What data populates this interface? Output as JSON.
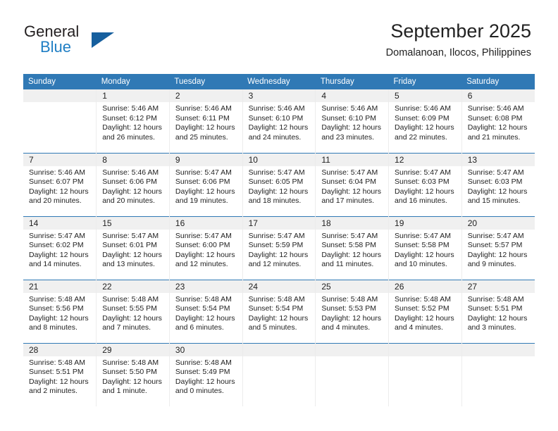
{
  "brand": {
    "name_part1": "General",
    "name_part2": "Blue",
    "logo_icon": "triangle-logo"
  },
  "header": {
    "title": "September 2025",
    "location": "Domalanoan, Ilocos, Philippines"
  },
  "colors": {
    "header_blue": "#3079b5",
    "brand_blue": "#1f7ec4",
    "logo_blue": "#165f9e",
    "day_strip_gray": "#f0f0f0"
  },
  "weekday_headers": [
    "Sunday",
    "Monday",
    "Tuesday",
    "Wednesday",
    "Thursday",
    "Friday",
    "Saturday"
  ],
  "weeks": [
    [
      {
        "day": "",
        "lines": []
      },
      {
        "day": "1",
        "lines": [
          "Sunrise: 5:46 AM",
          "Sunset: 6:12 PM",
          "Daylight: 12 hours",
          "and 26 minutes."
        ]
      },
      {
        "day": "2",
        "lines": [
          "Sunrise: 5:46 AM",
          "Sunset: 6:11 PM",
          "Daylight: 12 hours",
          "and 25 minutes."
        ]
      },
      {
        "day": "3",
        "lines": [
          "Sunrise: 5:46 AM",
          "Sunset: 6:10 PM",
          "Daylight: 12 hours",
          "and 24 minutes."
        ]
      },
      {
        "day": "4",
        "lines": [
          "Sunrise: 5:46 AM",
          "Sunset: 6:10 PM",
          "Daylight: 12 hours",
          "and 23 minutes."
        ]
      },
      {
        "day": "5",
        "lines": [
          "Sunrise: 5:46 AM",
          "Sunset: 6:09 PM",
          "Daylight: 12 hours",
          "and 22 minutes."
        ]
      },
      {
        "day": "6",
        "lines": [
          "Sunrise: 5:46 AM",
          "Sunset: 6:08 PM",
          "Daylight: 12 hours",
          "and 21 minutes."
        ]
      }
    ],
    [
      {
        "day": "7",
        "lines": [
          "Sunrise: 5:46 AM",
          "Sunset: 6:07 PM",
          "Daylight: 12 hours",
          "and 20 minutes."
        ]
      },
      {
        "day": "8",
        "lines": [
          "Sunrise: 5:46 AM",
          "Sunset: 6:06 PM",
          "Daylight: 12 hours",
          "and 20 minutes."
        ]
      },
      {
        "day": "9",
        "lines": [
          "Sunrise: 5:47 AM",
          "Sunset: 6:06 PM",
          "Daylight: 12 hours",
          "and 19 minutes."
        ]
      },
      {
        "day": "10",
        "lines": [
          "Sunrise: 5:47 AM",
          "Sunset: 6:05 PM",
          "Daylight: 12 hours",
          "and 18 minutes."
        ]
      },
      {
        "day": "11",
        "lines": [
          "Sunrise: 5:47 AM",
          "Sunset: 6:04 PM",
          "Daylight: 12 hours",
          "and 17 minutes."
        ]
      },
      {
        "day": "12",
        "lines": [
          "Sunrise: 5:47 AM",
          "Sunset: 6:03 PM",
          "Daylight: 12 hours",
          "and 16 minutes."
        ]
      },
      {
        "day": "13",
        "lines": [
          "Sunrise: 5:47 AM",
          "Sunset: 6:03 PM",
          "Daylight: 12 hours",
          "and 15 minutes."
        ]
      }
    ],
    [
      {
        "day": "14",
        "lines": [
          "Sunrise: 5:47 AM",
          "Sunset: 6:02 PM",
          "Daylight: 12 hours",
          "and 14 minutes."
        ]
      },
      {
        "day": "15",
        "lines": [
          "Sunrise: 5:47 AM",
          "Sunset: 6:01 PM",
          "Daylight: 12 hours",
          "and 13 minutes."
        ]
      },
      {
        "day": "16",
        "lines": [
          "Sunrise: 5:47 AM",
          "Sunset: 6:00 PM",
          "Daylight: 12 hours",
          "and 12 minutes."
        ]
      },
      {
        "day": "17",
        "lines": [
          "Sunrise: 5:47 AM",
          "Sunset: 5:59 PM",
          "Daylight: 12 hours",
          "and 12 minutes."
        ]
      },
      {
        "day": "18",
        "lines": [
          "Sunrise: 5:47 AM",
          "Sunset: 5:58 PM",
          "Daylight: 12 hours",
          "and 11 minutes."
        ]
      },
      {
        "day": "19",
        "lines": [
          "Sunrise: 5:47 AM",
          "Sunset: 5:58 PM",
          "Daylight: 12 hours",
          "and 10 minutes."
        ]
      },
      {
        "day": "20",
        "lines": [
          "Sunrise: 5:47 AM",
          "Sunset: 5:57 PM",
          "Daylight: 12 hours",
          "and 9 minutes."
        ]
      }
    ],
    [
      {
        "day": "21",
        "lines": [
          "Sunrise: 5:48 AM",
          "Sunset: 5:56 PM",
          "Daylight: 12 hours",
          "and 8 minutes."
        ]
      },
      {
        "day": "22",
        "lines": [
          "Sunrise: 5:48 AM",
          "Sunset: 5:55 PM",
          "Daylight: 12 hours",
          "and 7 minutes."
        ]
      },
      {
        "day": "23",
        "lines": [
          "Sunrise: 5:48 AM",
          "Sunset: 5:54 PM",
          "Daylight: 12 hours",
          "and 6 minutes."
        ]
      },
      {
        "day": "24",
        "lines": [
          "Sunrise: 5:48 AM",
          "Sunset: 5:54 PM",
          "Daylight: 12 hours",
          "and 5 minutes."
        ]
      },
      {
        "day": "25",
        "lines": [
          "Sunrise: 5:48 AM",
          "Sunset: 5:53 PM",
          "Daylight: 12 hours",
          "and 4 minutes."
        ]
      },
      {
        "day": "26",
        "lines": [
          "Sunrise: 5:48 AM",
          "Sunset: 5:52 PM",
          "Daylight: 12 hours",
          "and 4 minutes."
        ]
      },
      {
        "day": "27",
        "lines": [
          "Sunrise: 5:48 AM",
          "Sunset: 5:51 PM",
          "Daylight: 12 hours",
          "and 3 minutes."
        ]
      }
    ],
    [
      {
        "day": "28",
        "lines": [
          "Sunrise: 5:48 AM",
          "Sunset: 5:51 PM",
          "Daylight: 12 hours",
          "and 2 minutes."
        ]
      },
      {
        "day": "29",
        "lines": [
          "Sunrise: 5:48 AM",
          "Sunset: 5:50 PM",
          "Daylight: 12 hours",
          "and 1 minute."
        ]
      },
      {
        "day": "30",
        "lines": [
          "Sunrise: 5:48 AM",
          "Sunset: 5:49 PM",
          "Daylight: 12 hours",
          "and 0 minutes."
        ]
      },
      {
        "day": "",
        "lines": []
      },
      {
        "day": "",
        "lines": []
      },
      {
        "day": "",
        "lines": []
      },
      {
        "day": "",
        "lines": []
      }
    ]
  ]
}
